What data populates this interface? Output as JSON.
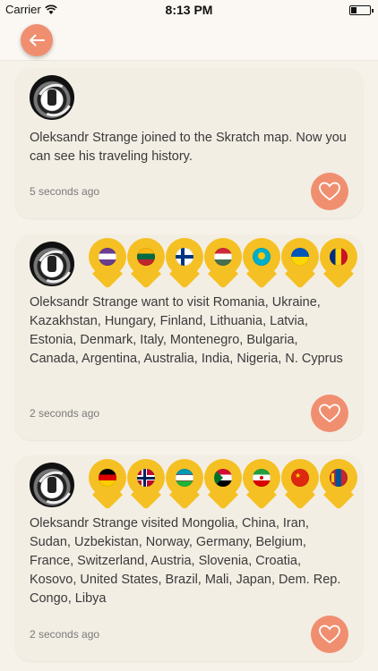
{
  "status_bar": {
    "carrier": "Carrier",
    "time": "8:13 PM"
  },
  "nav": {
    "back_icon": "back-arrow-icon"
  },
  "accent_color": "#f08f70",
  "pin_color": "#f5c023",
  "feed": [
    {
      "text": "Oleksandr Strange joined to the Skratch map. Now you can see his traveling history.",
      "time": "5 seconds ago",
      "flags": []
    },
    {
      "text": "Oleksandr Strange want to visit Romania, Ukraine, Kazakhstan, Hungary, Finland, Lithuania, Latvia, Estonia, Denmark, Italy, Montenegro, Bulgaria, Canada, Argentina, Australia, India, Nigeria, N. Cyprus",
      "time": "2 seconds ago",
      "flags": [
        "purple-white-stripes",
        "lithuania",
        "finland",
        "hungary",
        "kazakhstan",
        "ukraine",
        "romania"
      ]
    },
    {
      "text": "Oleksandr Strange visited Mongolia, China, Iran, Sudan, Uzbekistan, Norway, Germany, Belgium, France, Switzerland, Austria, Slovenia, Croatia, Kosovo, United States, Brazil, Mali, Japan, Dem. Rep. Congo, Libya",
      "time": "2 seconds ago",
      "flags": [
        "germany",
        "norway",
        "uzbekistan",
        "sudan",
        "iran",
        "china",
        "mongolia"
      ]
    }
  ]
}
